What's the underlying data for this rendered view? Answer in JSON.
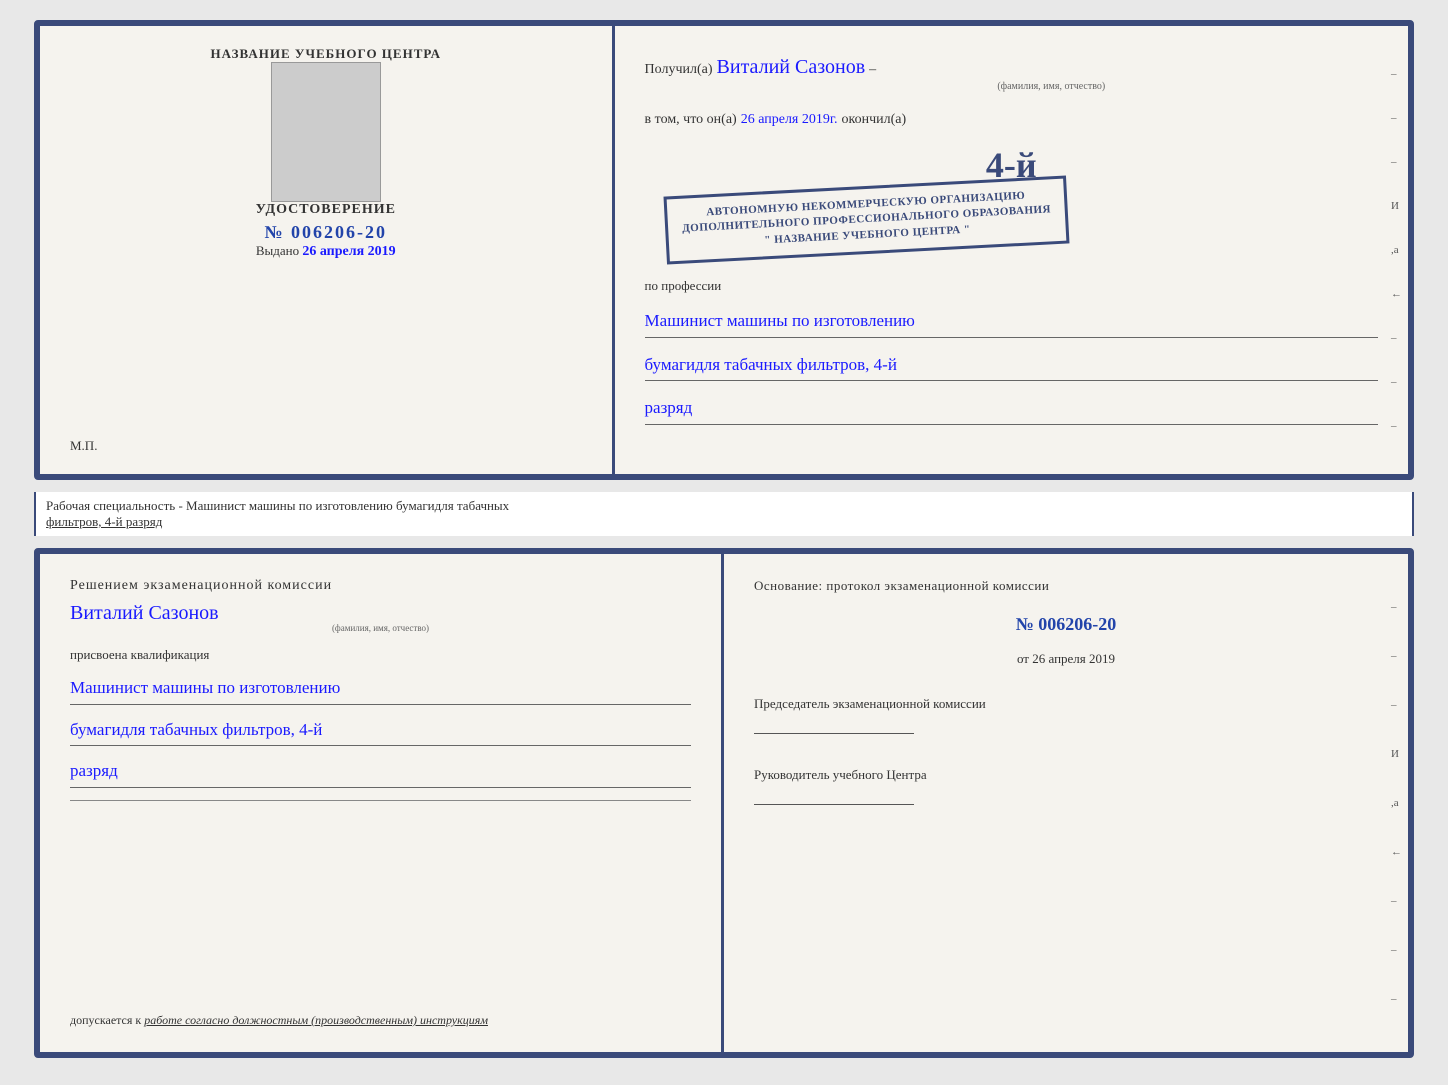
{
  "top_cert": {
    "left": {
      "org_label": "НАЗВАНИЕ УЧЕБНОГО ЦЕНТРА",
      "udostoverenie": "УДОСТОВЕРЕНИЕ",
      "number": "№ 006206-20",
      "vydano_label": "Выдано",
      "vydano_date": "26 апреля 2019",
      "mp_label": "М.П."
    },
    "right": {
      "poluchil_label": "Получил(а)",
      "fio_handwritten": "Виталий Сазонов",
      "fio_sub": "(фамилия, имя, отчество)",
      "dash": "–",
      "vtom_label": "в том, что он(а)",
      "date_handwritten": "26 апреля 2019г.",
      "okonchil_label": "окончил(а)",
      "stamp_line1": "АВТОНОМНУЮ НЕКОММЕРЧЕСКУЮ ОРГАНИЗАЦИЮ",
      "stamp_line2": "ДОПОЛНИТЕЛЬНОГО ПРОФЕССИОНАЛЬНОГО ОБРАЗОВАНИЯ",
      "stamp_line3": "\" НАЗВАНИЕ УЧЕБНОГО ЦЕНТРА \"",
      "stamp_big_number": "4-й",
      "po_professii_label": "по профессии",
      "profession_line1": "Машинист машины по изготовлению",
      "profession_line2": "бумагидля табачных фильтров, 4-й",
      "profession_line3": "разряд"
    }
  },
  "middle_label": {
    "text": "Рабочая специальность - Машинист машины по изготовлению бумагидля табачных",
    "underline_text": "фильтров, 4-й разряд"
  },
  "bottom_cert": {
    "left": {
      "resheniem_label": "Решением  экзаменационной  комиссии",
      "fio_handwritten": "Виталий Сазонов",
      "fio_sub": "(фамилия, имя, отчество)",
      "prisvoena_label": "присвоена квалификация",
      "qualification_line1": "Машинист машины по изготовлению",
      "qualification_line2": "бумагидля табачных фильтров, 4-й",
      "qualification_line3": "разряд",
      "dopuskaetsya_label": "допускается к",
      "dopuskaetsya_italic": "работе согласно должностным (производственным) инструкциям"
    },
    "right": {
      "osnovaniye_label": "Основание: протокол экзаменационной  комиссии",
      "protocol_number": "№  006206-20",
      "ot_label": "от",
      "ot_date": "26 апреля 2019",
      "predsedatel_label": "Председатель экзаменационной комиссии",
      "rukovoditel_label": "Руководитель учебного Центра"
    }
  },
  "dashes_right": [
    "–",
    "–",
    "–",
    "И",
    ",а",
    "←",
    "–",
    "–",
    "–"
  ],
  "dashes_right_bottom": [
    "–",
    "–",
    "–",
    "И",
    ",а",
    "←",
    "–",
    "–",
    "–"
  ]
}
